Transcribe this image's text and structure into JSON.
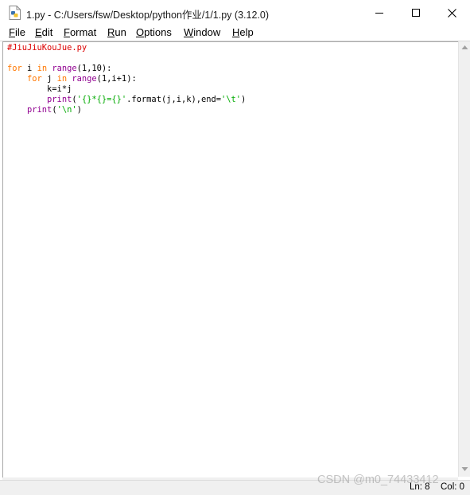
{
  "window": {
    "title": "1.py - C:/Users/fsw/Desktop/python作业/1/1.py (3.12.0)",
    "icon": "python-file-icon",
    "controls": [
      "minimize-icon",
      "maximize-icon",
      "close-icon"
    ]
  },
  "menu": [
    {
      "label": "File",
      "underline": "F",
      "rest": "ile"
    },
    {
      "label": "Edit",
      "underline": "E",
      "rest": "dit"
    },
    {
      "label": "Format",
      "underline": "F",
      "rest": "ormat"
    },
    {
      "label": "Run",
      "underline": "R",
      "rest": "un"
    },
    {
      "label": "Options",
      "underline": "O",
      "rest": "ptions"
    },
    {
      "label": "Window",
      "underline": "W",
      "rest": "indow"
    },
    {
      "label": "Help",
      "underline": "H",
      "rest": "elp"
    }
  ],
  "code_lines": [
    [
      {
        "t": "#JiuJiuKouJue.py",
        "c": "cm"
      }
    ],
    [],
    [
      {
        "t": "for",
        "c": "kw"
      },
      {
        "t": " i "
      },
      {
        "t": "in",
        "c": "kw"
      },
      {
        "t": " "
      },
      {
        "t": "range",
        "c": "bi"
      },
      {
        "t": "(1,10):"
      }
    ],
    [
      {
        "t": "    "
      },
      {
        "t": "for",
        "c": "kw"
      },
      {
        "t": " j "
      },
      {
        "t": "in",
        "c": "kw"
      },
      {
        "t": " "
      },
      {
        "t": "range",
        "c": "bi"
      },
      {
        "t": "(1,i+1):"
      }
    ],
    [
      {
        "t": "        k=i*j"
      }
    ],
    [
      {
        "t": "        "
      },
      {
        "t": "print",
        "c": "bi"
      },
      {
        "t": "("
      },
      {
        "t": "'{}*{}={}'",
        "c": "str"
      },
      {
        "t": ".format(j,i,k),end="
      },
      {
        "t": "'\\t'",
        "c": "str"
      },
      {
        "t": ")"
      }
    ],
    [
      {
        "t": "    "
      },
      {
        "t": "print",
        "c": "bi"
      },
      {
        "t": "("
      },
      {
        "t": "'\\n'",
        "c": "str"
      },
      {
        "t": ")"
      }
    ]
  ],
  "status": {
    "line": "Ln: 8",
    "col": "Col: 0"
  },
  "watermark": "CSDN @m0_74433412",
  "colors": {
    "keyword": "#ff7700",
    "builtin": "#900090",
    "string": "#00aa00",
    "comment": "#dd0000"
  }
}
